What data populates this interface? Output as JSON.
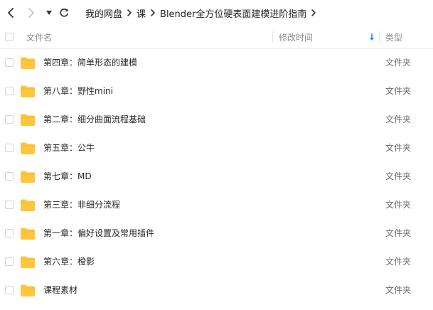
{
  "toolbar": {
    "back_icon": "chevron-left-icon",
    "forward_icon": "chevron-right-icon",
    "history_icon": "caret-down-icon",
    "refresh_icon": "refresh-icon"
  },
  "breadcrumb": [
    "我的网盘",
    "课",
    "Blender全方位硬表面建模进阶指南"
  ],
  "columns": {
    "name": "文件名",
    "modified": "修改时间",
    "type": "类型",
    "sort_icon": "sort-down-arrow-icon",
    "sort_color": "#1a8cff"
  },
  "folder_color": "#ffc53d",
  "files": [
    {
      "name": "第四章：简单形态的建模",
      "type": "文件夹"
    },
    {
      "name": "第八章：野性mini",
      "type": "文件夹"
    },
    {
      "name": "第二章：细分曲面流程基础",
      "type": "文件夹"
    },
    {
      "name": "第五章：公牛",
      "type": "文件夹"
    },
    {
      "name": "第七章：MD",
      "type": "文件夹"
    },
    {
      "name": "第三章：非细分流程",
      "type": "文件夹"
    },
    {
      "name": "第一章：偏好设置及常用插件",
      "type": "文件夹"
    },
    {
      "name": "第六章：橙影",
      "type": "文件夹"
    },
    {
      "name": "课程素材",
      "type": "文件夹"
    }
  ]
}
